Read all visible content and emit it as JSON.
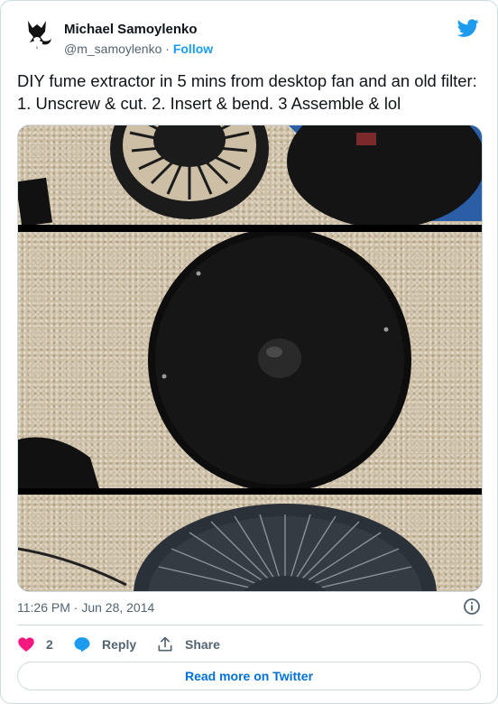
{
  "author": {
    "name": "Michael Samoylenko",
    "handle": "@m_samoylenko",
    "separator": " · ",
    "follow_label": "Follow",
    "avatar_icon": "fox-avatar"
  },
  "brand_icon": "twitter-bird-icon",
  "tweet": {
    "text": "DIY fume extractor in 5 mins from desktop fan and an old filter: 1. Unscrew & cut. 2. Insert & bend. 3 Assemble & lol",
    "timestamp": "11:26 PM · Jun 28, 2014"
  },
  "media": {
    "panels": [
      "fan-grille-and-filter-photo",
      "filter-inside-fan-photo",
      "assembled-fan-photo"
    ]
  },
  "actions": {
    "like_count": "2",
    "reply_label": "Reply",
    "share_label": "Share"
  },
  "read_more_label": "Read more on Twitter",
  "colors": {
    "accent": "#1d9bf0",
    "like": "#f91880",
    "text": "#0f1419",
    "muted": "#536471",
    "border": "#cfd9de",
    "link": "#006fd6"
  }
}
